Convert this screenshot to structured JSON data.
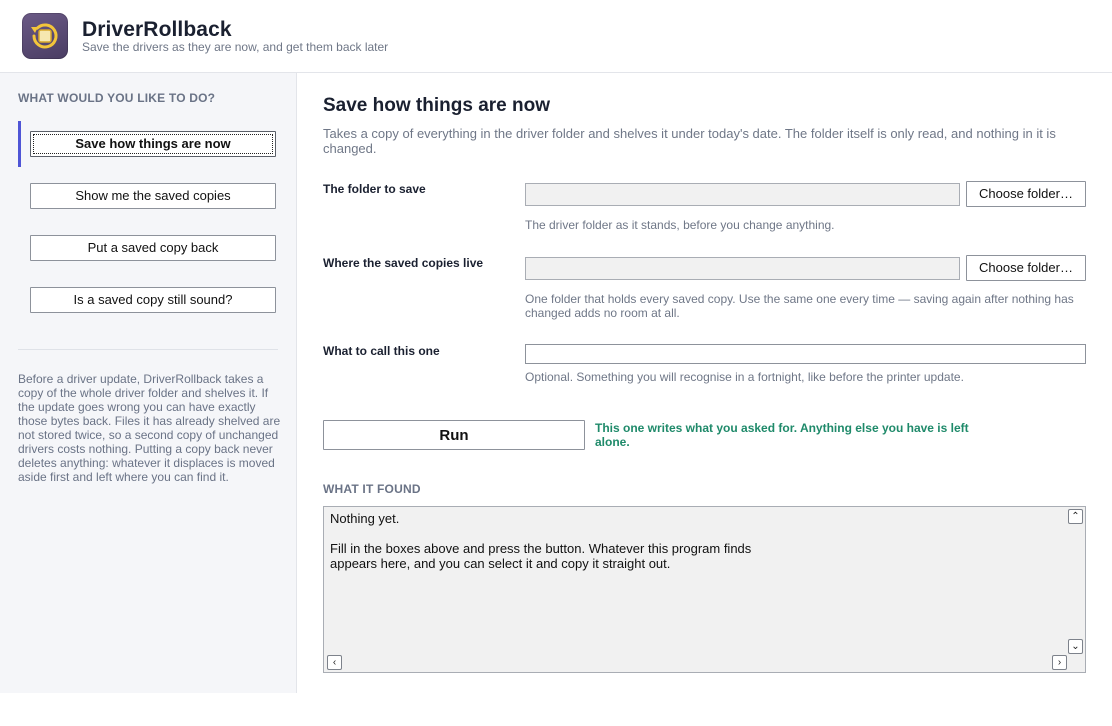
{
  "header": {
    "app_name": "DriverRollback",
    "tagline": "Save the drivers as they are now, and get them back later",
    "logo_icon": "driver-box-rollback-icon"
  },
  "sidebar": {
    "heading": "WHAT WOULD YOU LIKE TO DO?",
    "items": [
      {
        "label": "Save how things are now",
        "active": true
      },
      {
        "label": "Show me the saved copies",
        "active": false
      },
      {
        "label": "Put a saved copy back",
        "active": false
      },
      {
        "label": "Is a saved copy still sound?",
        "active": false
      }
    ],
    "description": "Before a driver update, DriverRollback takes a copy of the whole driver folder and shelves it. If the update goes wrong you can have exactly those bytes back. Files it has already shelved are not stored twice, so a second copy of unchanged drivers costs nothing. Putting a copy back never deletes anything: whatever it displaces is moved aside first and left where you can find it."
  },
  "main": {
    "title": "Save how things are now",
    "description": "Takes a copy of everything in the driver folder and shelves it under today's date. The folder itself is only read, and nothing in it is changed.",
    "fields": {
      "folder": {
        "label": "The folder to save",
        "value": "",
        "button": "Choose folder…",
        "hint": "The driver folder as it stands, before you change anything."
      },
      "store": {
        "label": "Where the saved copies live",
        "value": "",
        "button": "Choose folder…",
        "hint": "One folder that holds every saved copy. Use the same one every time — saving again after nothing has changed adds no room at all."
      },
      "name": {
        "label": "What to call this one",
        "value": "",
        "hint": "Optional. Something you will recognise in a fortnight, like before the printer update."
      }
    },
    "run_label": "Run",
    "run_note": "This one writes what you asked for. Anything else you have is left alone.",
    "found_heading": "WHAT IT FOUND",
    "output": "Nothing yet.\n\nFill in the boxes above and press the button. Whatever this program finds\nappears here, and you can select it and copy it straight out."
  },
  "colors": {
    "accent": "#4f55d6",
    "note_green": "#1f8a6a",
    "muted_text": "#6f7787",
    "sidebar_bg": "#f5f6f9"
  }
}
